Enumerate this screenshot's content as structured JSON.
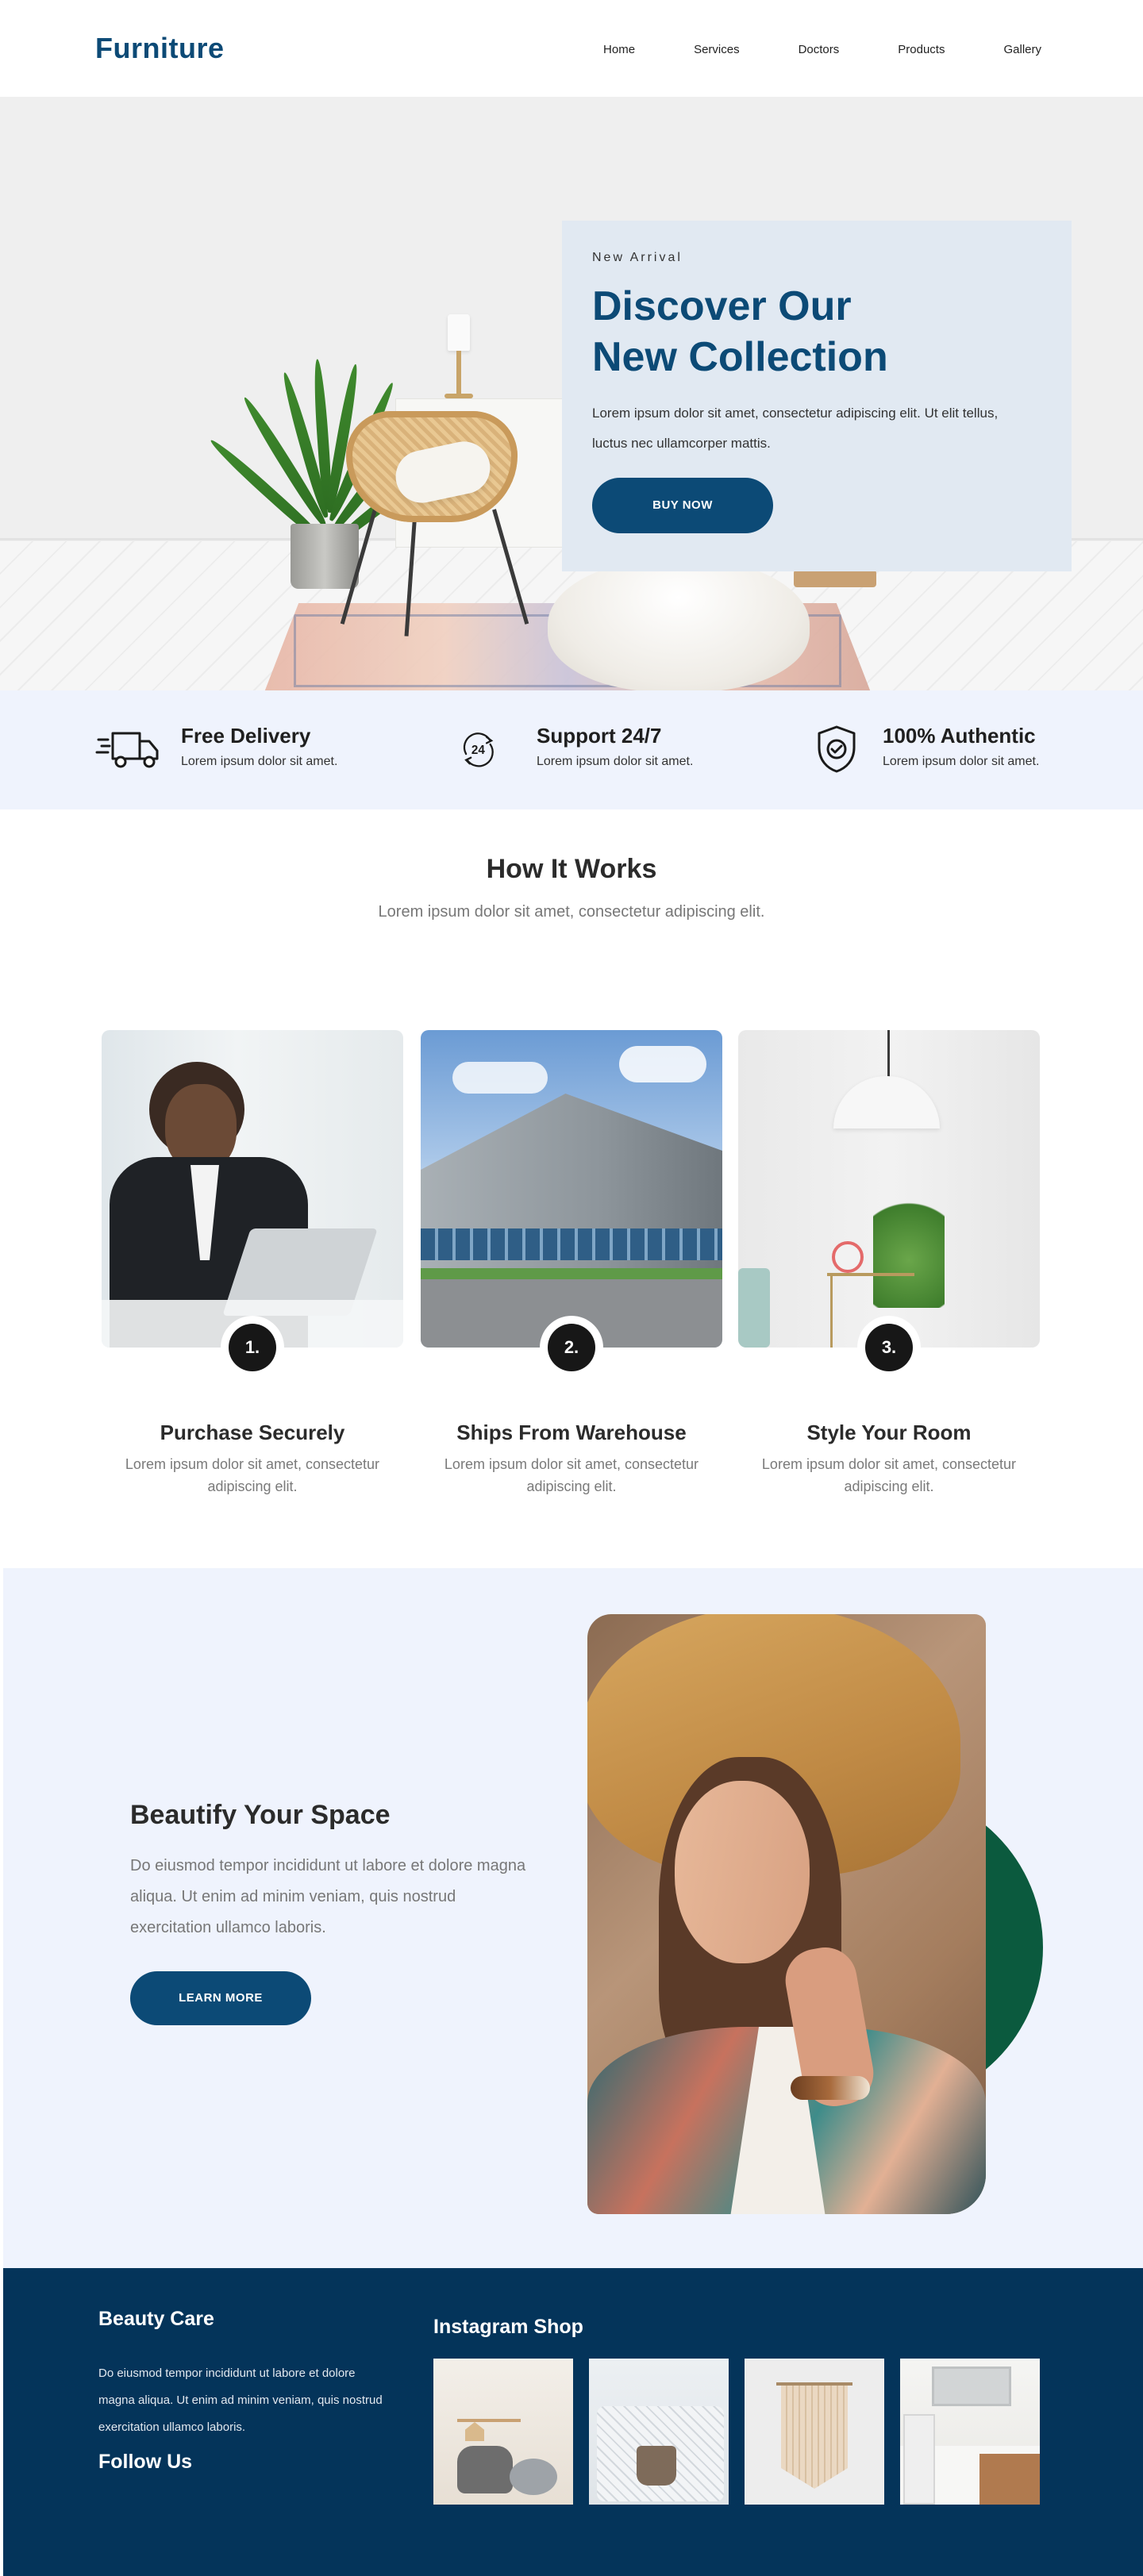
{
  "nav": {
    "logo": "Furniture",
    "links": [
      "Home",
      "Services",
      "Doctors",
      "Products",
      "Gallery"
    ]
  },
  "hero": {
    "eyebrow": "New Arrival",
    "title_line1": "Discover Our",
    "title_line2": "New Collection",
    "text": "Lorem ipsum dolor sit amet, consectetur adipiscing elit. Ut elit tellus, luctus nec ullamcorper mattis.",
    "button": "BUY NOW"
  },
  "features": [
    {
      "icon": "delivery-truck-icon",
      "title": "Free Delivery",
      "text": "Lorem ipsum dolor sit amet."
    },
    {
      "icon": "support-24-icon",
      "title": "Support 24/7",
      "text": "Lorem ipsum dolor sit amet."
    },
    {
      "icon": "shield-check-icon",
      "title": "100% Authentic",
      "text": "Lorem ipsum dolor sit amet."
    }
  ],
  "how": {
    "title": "How It Works",
    "subtitle": "Lorem ipsum dolor sit amet, consectetur adipiscing elit.",
    "steps": [
      {
        "number": "1.",
        "title": "Purchase Securely",
        "text": "Lorem ipsum dolor sit amet, consectetur adipiscing elit."
      },
      {
        "number": "2.",
        "title": "Ships From Warehouse",
        "text": "Lorem ipsum dolor sit amet, consectetur adipiscing elit."
      },
      {
        "number": "3.",
        "title": "Style Your Room",
        "text": "Lorem ipsum dolor sit amet, consectetur adipiscing elit."
      }
    ]
  },
  "beautify": {
    "title": "Beautify Your Space",
    "text": "Do eiusmod tempor incididunt ut labore et dolore magna aliqua. Ut enim ad minim veniam, quis nostrud exercitation ullamco laboris.",
    "button": "LEARN MORE"
  },
  "footer": {
    "brand": "Beauty Care",
    "text": "Do eiusmod tempor incididunt ut labore et dolore magna aliqua. Ut enim ad minim veniam, quis nostrud exercitation ullamco laboris.",
    "follow": "Follow Us",
    "instagram_title": "Instagram Shop"
  },
  "colors": {
    "brand": "#0c4a76",
    "footer_bg": "#04345a",
    "section_bg": "#eff3fd",
    "accent_green": "#0b5a3e"
  }
}
